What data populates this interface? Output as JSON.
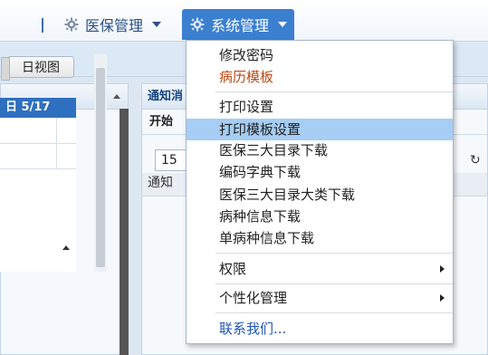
{
  "nav": {
    "items": [
      {
        "label": "医保管理",
        "icon": "gear-icon"
      },
      {
        "label": "系统管理",
        "icon": "gear-icon"
      }
    ]
  },
  "left_panel": {
    "day_view_button": "日视图",
    "date_header": "日 5/17"
  },
  "right_panel": {
    "header": "通知消",
    "column_header": "开始",
    "page_size": "15",
    "notice_label": "通知",
    "refresh_icon": "refresh-icon"
  },
  "menu": {
    "items": [
      {
        "label": "修改密码",
        "style": "normal"
      },
      {
        "label": "病历模板",
        "style": "red"
      },
      {
        "label": "打印设置",
        "style": "normal"
      },
      {
        "label": "打印模板设置",
        "style": "highlight"
      },
      {
        "label": "医保三大目录下载",
        "style": "normal"
      },
      {
        "label": "编码字典下载",
        "style": "normal"
      },
      {
        "label": "医保三大目录大类下载",
        "style": "normal"
      },
      {
        "label": "病种信息下载",
        "style": "normal"
      },
      {
        "label": "单病种信息下载",
        "style": "normal"
      },
      {
        "label": "权限",
        "style": "submenu"
      },
      {
        "label": "个性化管理",
        "style": "submenu"
      },
      {
        "label": "联系我们...",
        "style": "link"
      }
    ]
  },
  "colors": {
    "nav_active": "#3b7fd0",
    "highlight": "#a6cdf4",
    "date_bar": "#2f6fbf",
    "red_item": "#b84a14",
    "link": "#1f55b5"
  }
}
